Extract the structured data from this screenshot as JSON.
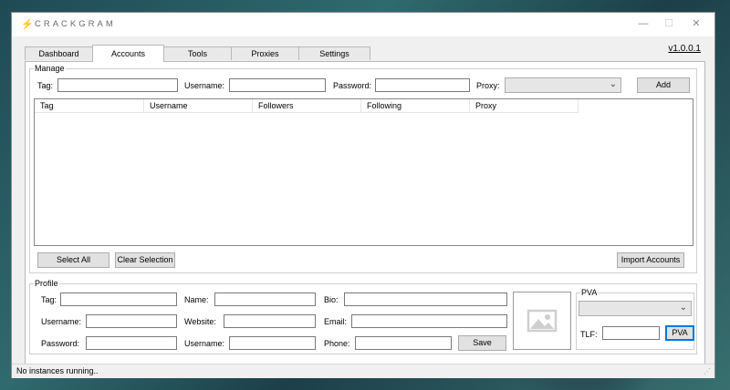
{
  "window": {
    "title": "CRACKGRAM",
    "version": "v1.0.0.1",
    "icon": "lightning-bolt-icon",
    "controls": [
      "minimize-icon",
      "maximize-icon",
      "close-icon"
    ]
  },
  "tabs": [
    "Dashboard",
    "Accounts",
    "Tools",
    "Proxies",
    "Settings"
  ],
  "active_tab": "Accounts",
  "manage": {
    "title": "Manage",
    "tag_label": "Tag:",
    "username_label": "Username:",
    "password_label": "Password:",
    "proxy_label": "Proxy:",
    "add_label": "Add"
  },
  "accounts_list": {
    "columns": [
      "Tag",
      "Username",
      "Followers",
      "Following",
      "Proxy"
    ],
    "rows": []
  },
  "list_actions": {
    "select_all": "Select All",
    "clear_selection": "Clear Selection",
    "import_accounts": "Import Accounts"
  },
  "profile": {
    "title": "Profile",
    "tag_label": "Tag:",
    "username_label": "Username:",
    "password_label": "Password:",
    "name_label": "Name:",
    "website_label": "Website:",
    "username2_label": "Username:",
    "bio_label": "Bio:",
    "email_label": "Email:",
    "phone_label": "Phone:",
    "save_label": "Save",
    "image_icon": "image-placeholder-icon"
  },
  "pva": {
    "title": "PVA",
    "tlf_label": "TLF:",
    "button_label": "PVA"
  },
  "status": {
    "text": "No instances running.."
  }
}
